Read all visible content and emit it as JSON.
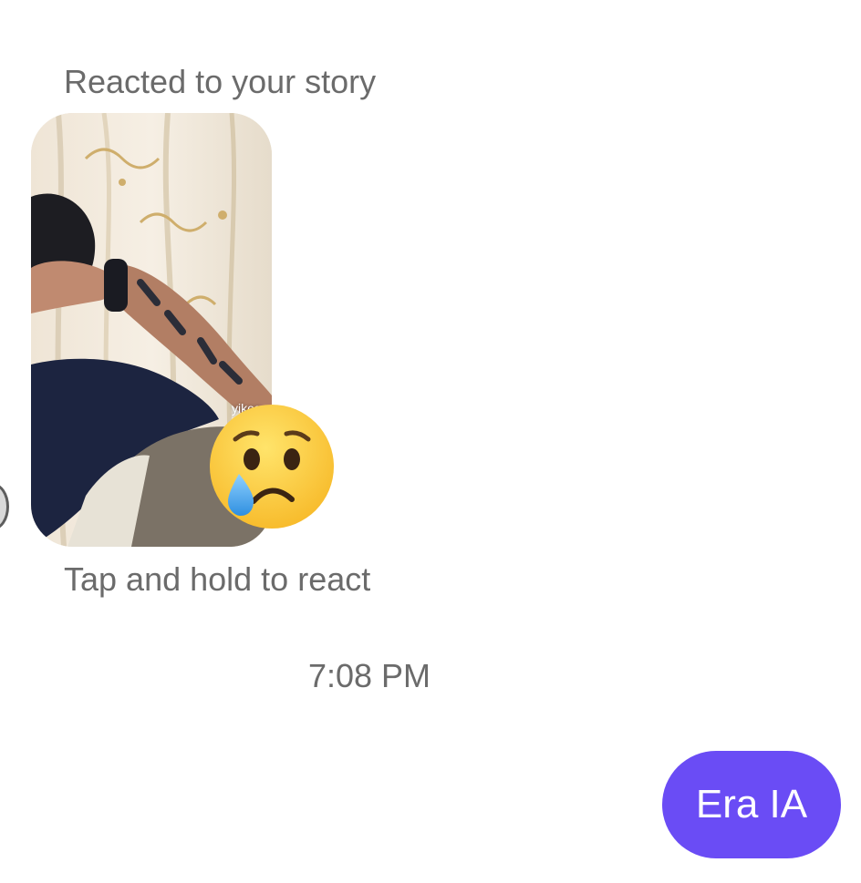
{
  "story_reply": {
    "reacted_label": "Reacted to your story",
    "story_caption": "yikes",
    "reaction_emoji": "crying-face",
    "hint_label": "Tap and hold to react"
  },
  "timestamp": "7:08 PM",
  "outgoing_message": {
    "text": "Era IA",
    "bubble_color": "#6a4cf5"
  }
}
